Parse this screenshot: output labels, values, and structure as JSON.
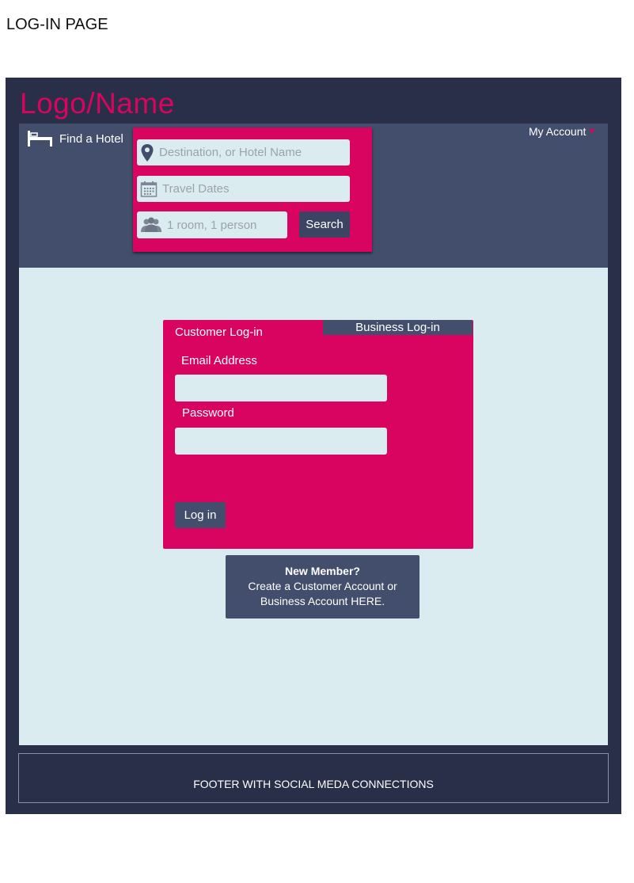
{
  "page_title": "LOG-IN PAGE",
  "header": {
    "logo": "Logo/Name",
    "find_hotel_label": "Find a Hotel",
    "my_account_label": "My Account"
  },
  "search": {
    "destination_placeholder": "Destination, or Hotel Name",
    "dates_placeholder": "Travel Dates",
    "guests_value": "1 room, 1 person",
    "search_button_label": "Search"
  },
  "login": {
    "tab_customer": "Customer Log-in",
    "tab_business": "Business Log-in",
    "email_label": "Email Address",
    "email_value": "",
    "password_label": "Password",
    "password_value": "",
    "login_button_label": "Log in"
  },
  "new_member": {
    "heading": "New Member?",
    "line1": "Create a Customer Account or",
    "line2": "Business Account HERE."
  },
  "footer": {
    "text": "FOOTER WITH SOCIAL MEDA CONNECTIONS"
  },
  "colors": {
    "brand_pink": "#d9045f",
    "dark_navy": "#292f48",
    "slate": "#434e6c",
    "light_blue": "#dbecf1"
  },
  "icons": [
    "bed-icon",
    "map-pin-icon",
    "calendar-icon",
    "people-icon",
    "caret-down-icon"
  ]
}
